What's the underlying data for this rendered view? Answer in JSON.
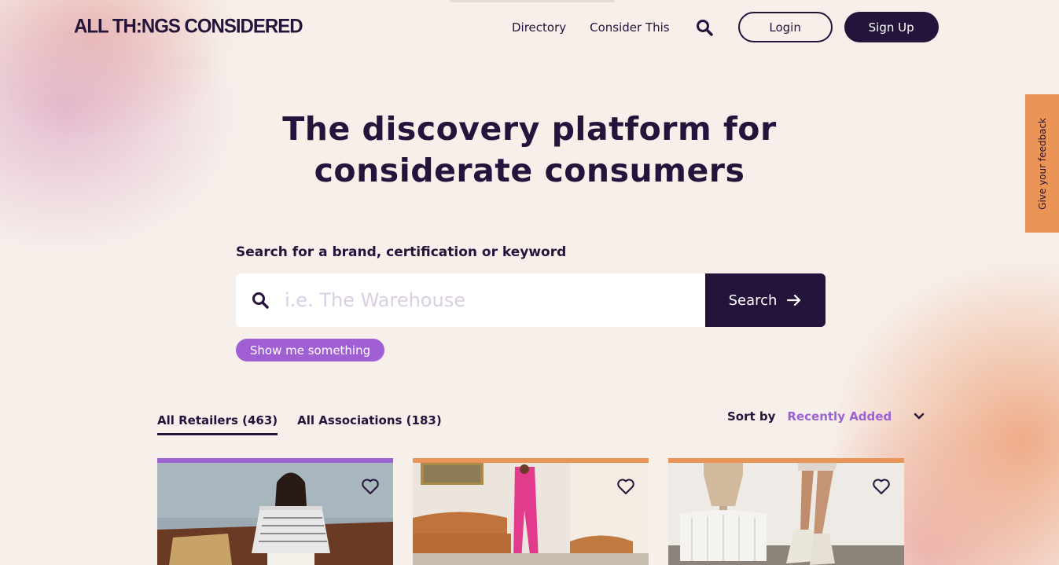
{
  "brand": {
    "logo": "ALL TH:NGS CONSIDERED"
  },
  "nav": {
    "directory": "Directory",
    "consider_this": "Consider This",
    "login": "Login",
    "signup": "Sign Up"
  },
  "feedback": {
    "label": "Give your feedback"
  },
  "hero": {
    "title_line1": "The discovery platform for",
    "title_line2": "considerate consumers"
  },
  "search": {
    "label": "Search for a brand, certification or keyword",
    "placeholder": "i.e. The Warehouse",
    "button": "Search",
    "suggest": "Show me something"
  },
  "tabs": [
    {
      "label": "All Retailers (463)",
      "active": true
    },
    {
      "label": "All Associations (183)",
      "active": false
    }
  ],
  "sort": {
    "label": "Sort by",
    "value": "Recently Added"
  },
  "cards": [
    {
      "accent": "#9c62d4",
      "icon": "heart-icon"
    },
    {
      "accent": "#ea9557",
      "icon": "heart-icon"
    },
    {
      "accent": "#ea9557",
      "icon": "heart-icon"
    }
  ],
  "colors": {
    "primary": "#24133a",
    "accent_purple": "#a05fd3",
    "accent_orange": "#ea9557"
  }
}
